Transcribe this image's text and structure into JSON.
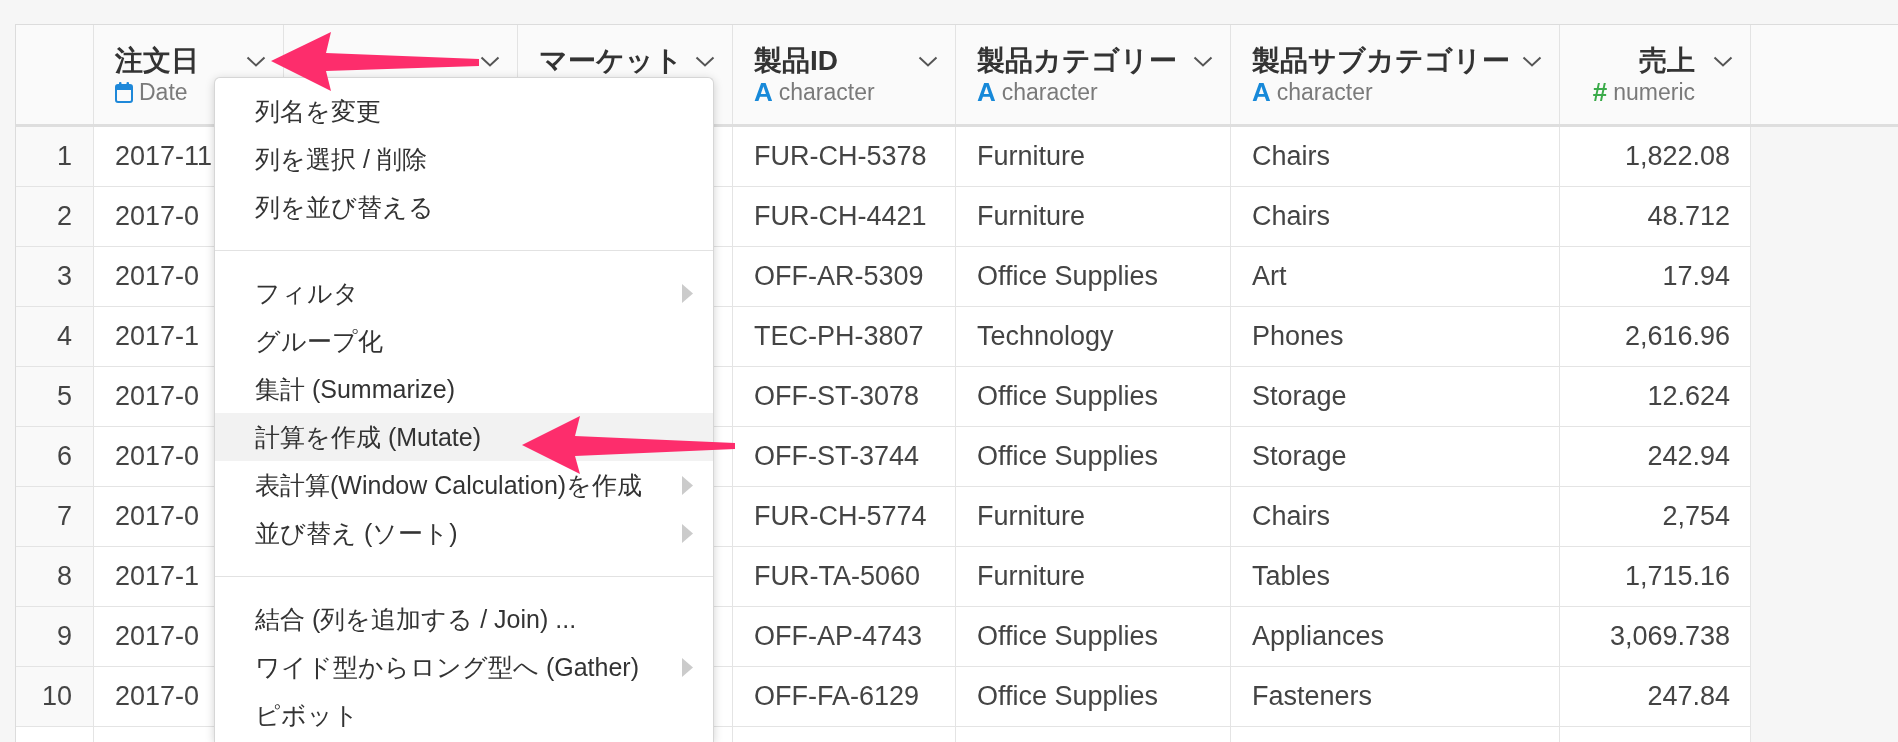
{
  "table": {
    "columns": [
      {
        "title": "注文日",
        "menu_button": true,
        "type": {
          "kind": "date",
          "label": "Date"
        }
      },
      {
        "menu_button": true
      },
      {
        "title": "マーケット",
        "menu_button": true
      },
      {
        "title": "製品ID",
        "menu_button": true,
        "type": {
          "kind": "character",
          "glyph": "A",
          "label": "character"
        }
      },
      {
        "title": "製品カテゴリー",
        "menu_button": true,
        "type": {
          "kind": "character",
          "glyph": "A",
          "label": "character"
        }
      },
      {
        "title": "製品サブカテゴリー",
        "menu_button": true,
        "type": {
          "kind": "character",
          "glyph": "A",
          "label": "character"
        }
      },
      {
        "title": "売上",
        "menu_button": true,
        "type": {
          "kind": "numeric",
          "glyph": "#",
          "label": "numeric"
        }
      }
    ],
    "rows": [
      {
        "number": "1",
        "cells": [
          "2017-11",
          null,
          null,
          "FUR-CH-5378",
          "Furniture",
          "Chairs",
          "1,822.08"
        ]
      },
      {
        "number": "2",
        "cells": [
          "2017-0",
          null,
          null,
          "FUR-CH-4421",
          "Furniture",
          "Chairs",
          "48.712"
        ]
      },
      {
        "number": "3",
        "cells": [
          "2017-0",
          null,
          null,
          "OFF-AR-5309",
          "Office Supplies",
          "Art",
          "17.94"
        ]
      },
      {
        "number": "4",
        "cells": [
          "2017-1",
          null,
          null,
          "TEC-PH-3807",
          "Technology",
          "Phones",
          "2,616.96"
        ]
      },
      {
        "number": "5",
        "cells": [
          "2017-0",
          null,
          null,
          "OFF-ST-3078",
          "Office Supplies",
          "Storage",
          "12.624"
        ]
      },
      {
        "number": "6",
        "cells": [
          "2017-0",
          null,
          null,
          "OFF-ST-3744",
          "Office Supplies",
          "Storage",
          "242.94"
        ]
      },
      {
        "number": "7",
        "cells": [
          "2017-0",
          null,
          null,
          "FUR-CH-5774",
          "Furniture",
          "Chairs",
          "2,754"
        ]
      },
      {
        "number": "8",
        "cells": [
          "2017-1",
          null,
          null,
          "FUR-TA-5060",
          "Furniture",
          "Tables",
          "1,715.16"
        ]
      },
      {
        "number": "9",
        "cells": [
          "2017-0",
          null,
          null,
          "OFF-AP-4743",
          "Office Supplies",
          "Appliances",
          "3,069.738"
        ]
      },
      {
        "number": "10",
        "cells": [
          "2017-0",
          null,
          null,
          "OFF-FA-6129",
          "Office Supplies",
          "Fasteners",
          "247.84"
        ]
      }
    ]
  },
  "column_menu": {
    "groups": [
      {
        "items": [
          {
            "label": "列名を変更",
            "submenu": false,
            "selected": false
          },
          {
            "label": "列を選択 / 削除",
            "submenu": false,
            "selected": false
          },
          {
            "label": "列を並び替える",
            "submenu": false,
            "selected": false
          }
        ]
      },
      {
        "items": [
          {
            "label": "フィルタ",
            "submenu": true,
            "selected": false
          },
          {
            "label": "グループ化",
            "submenu": false,
            "selected": false
          },
          {
            "label": "集計 (Summarize)",
            "submenu": false,
            "selected": false
          },
          {
            "label": "計算を作成 (Mutate)",
            "submenu": false,
            "selected": true
          },
          {
            "label": "表計算(Window Calculation)を作成",
            "submenu": true,
            "selected": false
          },
          {
            "label": "並び替え (ソート)",
            "submenu": true,
            "selected": false
          }
        ]
      },
      {
        "items": [
          {
            "label": "結合 (列を追加する / Join) ...",
            "submenu": false,
            "selected": false
          },
          {
            "label": "ワイド型からロング型へ (Gather)",
            "submenu": true,
            "selected": false
          },
          {
            "label": "ピボット",
            "submenu": false,
            "selected": false
          }
        ]
      }
    ]
  }
}
